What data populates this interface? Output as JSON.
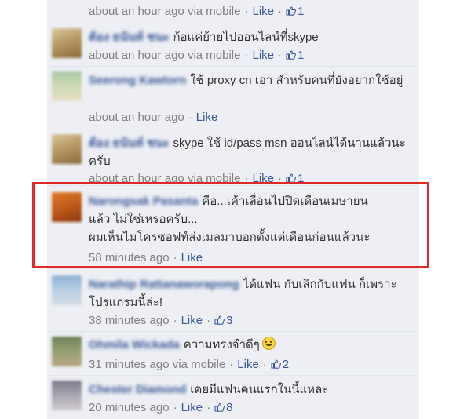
{
  "comments": [
    {
      "name": "",
      "message": "",
      "time": "about an hour ago via mobile",
      "like_label": "Like",
      "like_count": "1"
    },
    {
      "name": "ต้อง ธนันท์ ชนะ",
      "message": "ก้อแค่ย้ายไปออนไลน์ที่skype",
      "time": "about an hour ago via mobile",
      "like_label": "Like",
      "like_count": "1"
    },
    {
      "name": "Seerong Kawtorn",
      "message": "ใช้ proxy cn เอา สำหรับคนที่ยังอยากใช้อยู่",
      "time": "about an hour ago",
      "like_label": "Like",
      "like_count": ""
    },
    {
      "name": "ต้อง ธนันท์ ชนะ",
      "message": "skype ใช้ id/pass msn ออนไลน์ได้นานแล้วนะครับ",
      "time": "about an hour ago via mobile",
      "like_label": "Like",
      "like_count": "1"
    },
    {
      "name": "Narongsak Pasanta",
      "message": "คือ...เค้าเลื่อนไปปิดเดือนเมษายนแล้ว ไม่ใช่เหรอครับ...",
      "message2": "ผมเห็นไมโครซอฟท์ส่งเมลมาบอกตั้งแต่เดือนก่อนแล้วนะ",
      "time": "58 minutes ago",
      "like_label": "Like",
      "like_count": ""
    },
    {
      "name": "Narathip Rattanaworapong",
      "message": "ได้แฟน กับเลิกกับแฟน ก็เพราะโปรแกรมนี้ล่ะ!",
      "time": "38 minutes ago",
      "like_label": "Like",
      "like_count": "3"
    },
    {
      "name": "Ohmila Wickada",
      "message": "ความทรงจำดีๆ",
      "time": "31 minutes ago via mobile",
      "like_label": "Like",
      "like_count": "2"
    },
    {
      "name": "Chester Diamond",
      "message": "เคยมีแฟนคนแรกในนี้แหละ",
      "time": "20 minutes ago",
      "like_label": "Like",
      "like_count": "8"
    }
  ],
  "colors": {
    "panel_bg": "#edeff4",
    "link": "#3b5998",
    "meta": "#808080",
    "highlight": "#e02a2a"
  }
}
